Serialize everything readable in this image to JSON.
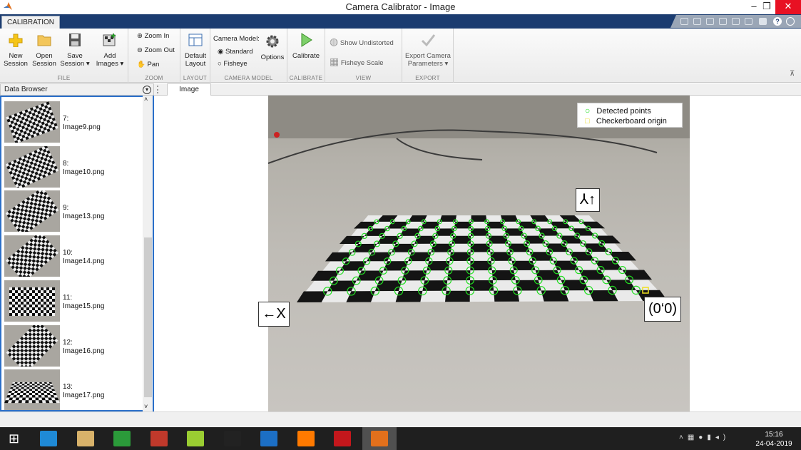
{
  "window": {
    "title": "Camera Calibrator - Image",
    "minimize": "–",
    "restore": "❐",
    "close": "✕"
  },
  "tabs": {
    "active": "CALIBRATION"
  },
  "ribbon": {
    "file": {
      "label": "FILE",
      "new_session": "New Session",
      "open_session": "Open Session",
      "save_session": "Save Session ▾",
      "add_images": "Add Images ▾"
    },
    "zoom": {
      "label": "ZOOM",
      "zoom_in": "Zoom In",
      "zoom_out": "Zoom Out",
      "pan": "Pan"
    },
    "layout": {
      "label": "LAYOUT",
      "default_layout": "Default Layout"
    },
    "camera_model": {
      "label": "CAMERA MODEL",
      "title": "Camera Model:",
      "standard": "Standard",
      "fisheye": "Fisheye",
      "options": "Options",
      "selected": "Standard"
    },
    "calibrate": {
      "label": "CALIBRATE",
      "calibrate": "Calibrate"
    },
    "view": {
      "label": "VIEW",
      "show_undistorted": "Show Undistorted",
      "fisheye_scale": "Fisheye Scale"
    },
    "export": {
      "label": "EXPORT",
      "export_params": "Export Camera Parameters ▾"
    }
  },
  "data_browser": {
    "title": "Data Browser",
    "items": [
      {
        "index": "7:",
        "name": "Image9.png"
      },
      {
        "index": "8:",
        "name": "Image10.png"
      },
      {
        "index": "9:",
        "name": "Image13.png"
      },
      {
        "index": "10:",
        "name": "Image14.png"
      },
      {
        "index": "11:",
        "name": "Image15.png"
      },
      {
        "index": "12:",
        "name": "Image16.png"
      },
      {
        "index": "13:",
        "name": "Image17.png"
      }
    ]
  },
  "image_panel": {
    "tab": "Image",
    "legend": {
      "detected": "Detected points",
      "origin": "Checkerboard origin"
    },
    "axis_x": "←X",
    "axis_y": "⅄↑",
    "origin_label": "(0‘0)"
  },
  "colors": {
    "accent": "#1b3c70",
    "detected": "#22dd22",
    "origin": "#f0e020",
    "selection": "#2a6fc9"
  },
  "taskbar": {
    "apps": [
      "windows-icon",
      "ie-icon",
      "file-explorer-icon",
      "store-icon",
      "app-red-icon",
      "notepad-icon",
      "dice-app-icon",
      "ic-app-icon",
      "firefox-icon",
      "acrobat-icon",
      "matlab-icon"
    ],
    "time": "15:16",
    "date": "24-04-2019"
  }
}
